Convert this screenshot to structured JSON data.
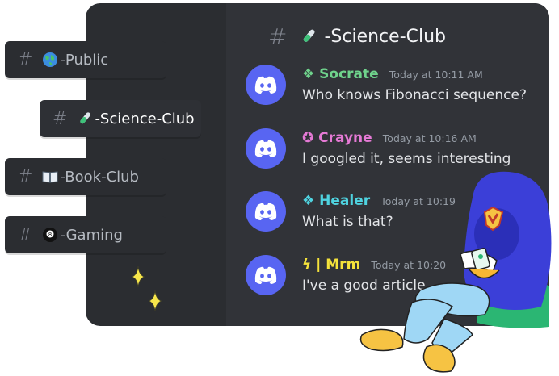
{
  "channel_header": {
    "name": "-Science-Club"
  },
  "channels": [
    {
      "name": "-Public",
      "icon": "globe-icon"
    },
    {
      "name": "-Science-Club",
      "icon": "test-tube-icon",
      "active": true
    },
    {
      "name": "-Book-Club",
      "icon": "book-icon"
    },
    {
      "name": "-Gaming",
      "icon": "8-ball-icon"
    }
  ],
  "messages": [
    {
      "prefix": "❖",
      "author": "Socrate",
      "author_color": "#6fd38c",
      "time": "Today at 10:11 AM",
      "text": "Who knows Fibonacci sequence?"
    },
    {
      "prefix": "✪",
      "author": "Crayne",
      "author_color": "#e67ad6",
      "time": "Today at 10:16 AM",
      "text": "I googled it, seems interesting"
    },
    {
      "prefix": "❖",
      "author": "Healer",
      "author_color": "#4fd3e0",
      "time": "Today at 10:19",
      "text": "What is that?"
    },
    {
      "prefix": "ϟ |",
      "author": "Mrm",
      "author_color": "#f5e33b",
      "time": "Today at 10:20",
      "text": "I've a good article"
    }
  ],
  "colors": {
    "brand": "#5865f2",
    "background": "#313338",
    "sidebar": "#2b2d31"
  }
}
